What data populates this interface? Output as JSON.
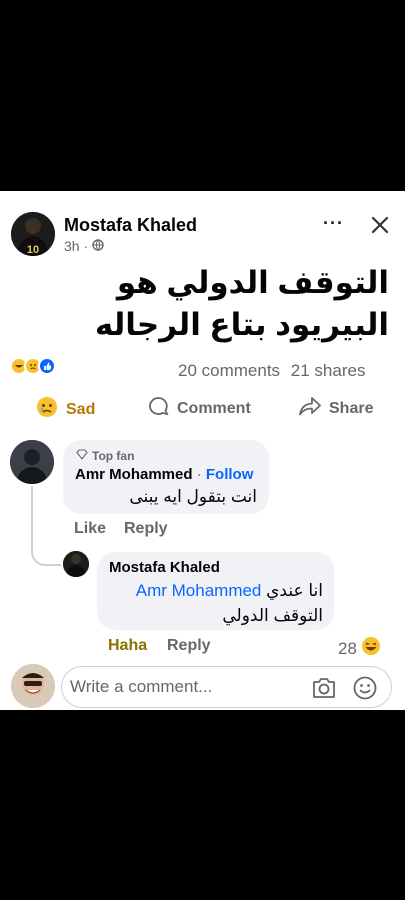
{
  "post": {
    "author": "Mostafa Khaled",
    "time": "3h",
    "text": "التوقف الدولي هو البيريود بتاع الرجاله",
    "comments_count": "20 comments",
    "shares_count": "21 shares",
    "more_icon": "more-dots-icon",
    "close_icon": "close-icon",
    "privacy_icon": "globe-icon"
  },
  "actions": {
    "sad": "Sad",
    "comment": "Comment",
    "share": "Share"
  },
  "comments": [
    {
      "badge": "Top fan",
      "author": "Amr Mohammed",
      "follow": "Follow",
      "text": "انت بتقول ايه يبنى",
      "like": "Like",
      "reply": "Reply"
    },
    {
      "author": "Mostafa Khaled",
      "mention": "Amr Mohammed",
      "text_part": "انا عندي",
      "text_line2": "التوقف الدولي",
      "reaction": "Haha",
      "reply": "Reply",
      "reaction_count": "28"
    }
  ],
  "composer": {
    "placeholder": "Write a comment...",
    "camera_icon": "camera-icon",
    "emoji_icon": "emoji-icon"
  },
  "colors": {
    "link": "#0866ff",
    "muted": "#65676b",
    "bubble": "#f0f2f5",
    "sad": "#b97800",
    "haha": "#8b6f00"
  }
}
